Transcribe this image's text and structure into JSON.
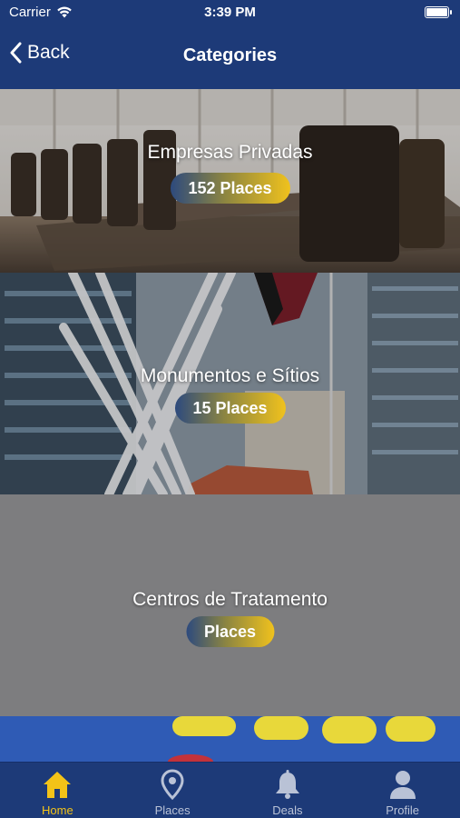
{
  "status_bar": {
    "carrier": "Carrier",
    "time": "3:39 PM"
  },
  "nav": {
    "back_label": "Back",
    "title": "Categories"
  },
  "categories": [
    {
      "name": "Empresas Privadas",
      "badge": "152 Places"
    },
    {
      "name": "Monumentos e Sítios",
      "badge": "15 Places"
    },
    {
      "name": "Centros de Tratamento",
      "badge": "Places"
    }
  ],
  "tabs": [
    {
      "label": "Home",
      "icon": "home-icon",
      "active": true
    },
    {
      "label": "Places",
      "icon": "map-pin-icon",
      "active": false
    },
    {
      "label": "Deals",
      "icon": "bell-icon",
      "active": false
    },
    {
      "label": "Profile",
      "icon": "person-icon",
      "active": false
    }
  ],
  "colors": {
    "primary": "#1d3a78",
    "accent": "#f3c318",
    "inactive_tab": "#b9c2d6",
    "placeholder_card": "#7d7d7f"
  }
}
